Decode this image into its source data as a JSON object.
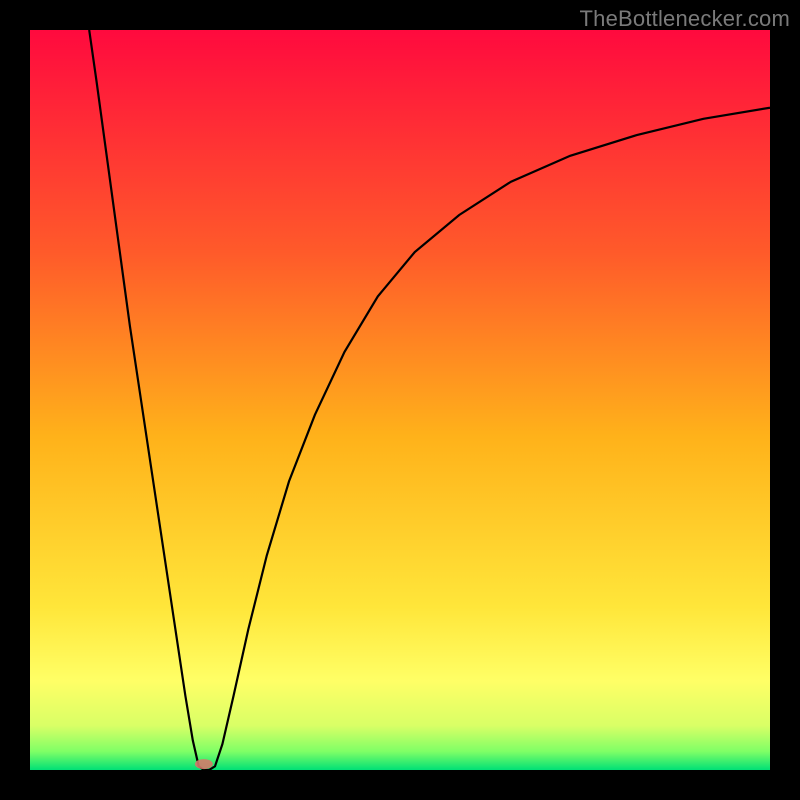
{
  "watermark": "TheBottlenecker.com",
  "chart_data": {
    "type": "line",
    "title": "",
    "xlabel": "",
    "ylabel": "",
    "xlim": [
      0,
      100
    ],
    "ylim": [
      0,
      100
    ],
    "grid": false,
    "legend": false,
    "background_gradient": {
      "stops": [
        {
          "pos": 0.0,
          "color": "#ff0a3e"
        },
        {
          "pos": 0.3,
          "color": "#ff5a2a"
        },
        {
          "pos": 0.55,
          "color": "#ffb21a"
        },
        {
          "pos": 0.78,
          "color": "#ffe63a"
        },
        {
          "pos": 0.88,
          "color": "#ffff66"
        },
        {
          "pos": 0.94,
          "color": "#d9ff66"
        },
        {
          "pos": 0.975,
          "color": "#7fff66"
        },
        {
          "pos": 1.0,
          "color": "#00e076"
        }
      ]
    },
    "curve_points": [
      {
        "x": 8.0,
        "y": 100.0
      },
      {
        "x": 9.0,
        "y": 93.0
      },
      {
        "x": 10.5,
        "y": 82.0
      },
      {
        "x": 12.0,
        "y": 71.0
      },
      {
        "x": 13.5,
        "y": 60.0
      },
      {
        "x": 15.0,
        "y": 50.0
      },
      {
        "x": 16.5,
        "y": 40.0
      },
      {
        "x": 18.0,
        "y": 30.0
      },
      {
        "x": 19.5,
        "y": 20.0
      },
      {
        "x": 21.0,
        "y": 10.0
      },
      {
        "x": 22.0,
        "y": 4.0
      },
      {
        "x": 22.8,
        "y": 0.5
      },
      {
        "x": 23.5,
        "y": 0.0
      },
      {
        "x": 24.2,
        "y": 0.0
      },
      {
        "x": 25.0,
        "y": 0.5
      },
      {
        "x": 26.0,
        "y": 3.5
      },
      {
        "x": 27.5,
        "y": 10.0
      },
      {
        "x": 29.5,
        "y": 19.0
      },
      {
        "x": 32.0,
        "y": 29.0
      },
      {
        "x": 35.0,
        "y": 39.0
      },
      {
        "x": 38.5,
        "y": 48.0
      },
      {
        "x": 42.5,
        "y": 56.5
      },
      {
        "x": 47.0,
        "y": 64.0
      },
      {
        "x": 52.0,
        "y": 70.0
      },
      {
        "x": 58.0,
        "y": 75.0
      },
      {
        "x": 65.0,
        "y": 79.5
      },
      {
        "x": 73.0,
        "y": 83.0
      },
      {
        "x": 82.0,
        "y": 85.8
      },
      {
        "x": 91.0,
        "y": 88.0
      },
      {
        "x": 100.0,
        "y": 89.5
      }
    ],
    "marker": {
      "x": 23.5,
      "y": 0.8,
      "rx": 9,
      "ry": 5,
      "color": "#d47a6a"
    }
  }
}
